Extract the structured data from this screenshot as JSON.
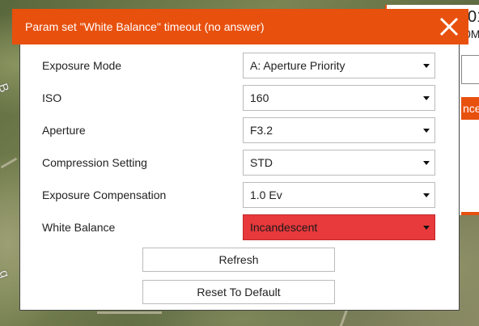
{
  "dialog": {
    "title": "Param set \"White Balance\" timeout (no answer)",
    "close_icon": "close-icon"
  },
  "params": [
    {
      "label": "Exposure Mode",
      "value": "A: Aperture Priority"
    },
    {
      "label": "ISO",
      "value": "160"
    },
    {
      "label": "Aperture",
      "value": "F3.2"
    },
    {
      "label": "Compression Setting",
      "value": "STD"
    },
    {
      "label": "Exposure Compensation",
      "value": "1.0 Ev"
    },
    {
      "label": "White Balance",
      "value": "Incandescent",
      "error": true
    }
  ],
  "buttons": {
    "refresh": "Refresh",
    "reset": "Reset To Default"
  },
  "background": {
    "value_top": "01",
    "value_sub": "0M",
    "orange_text": "nce"
  },
  "colors": {
    "accent": "#e8500e",
    "error": "#e8393c"
  }
}
